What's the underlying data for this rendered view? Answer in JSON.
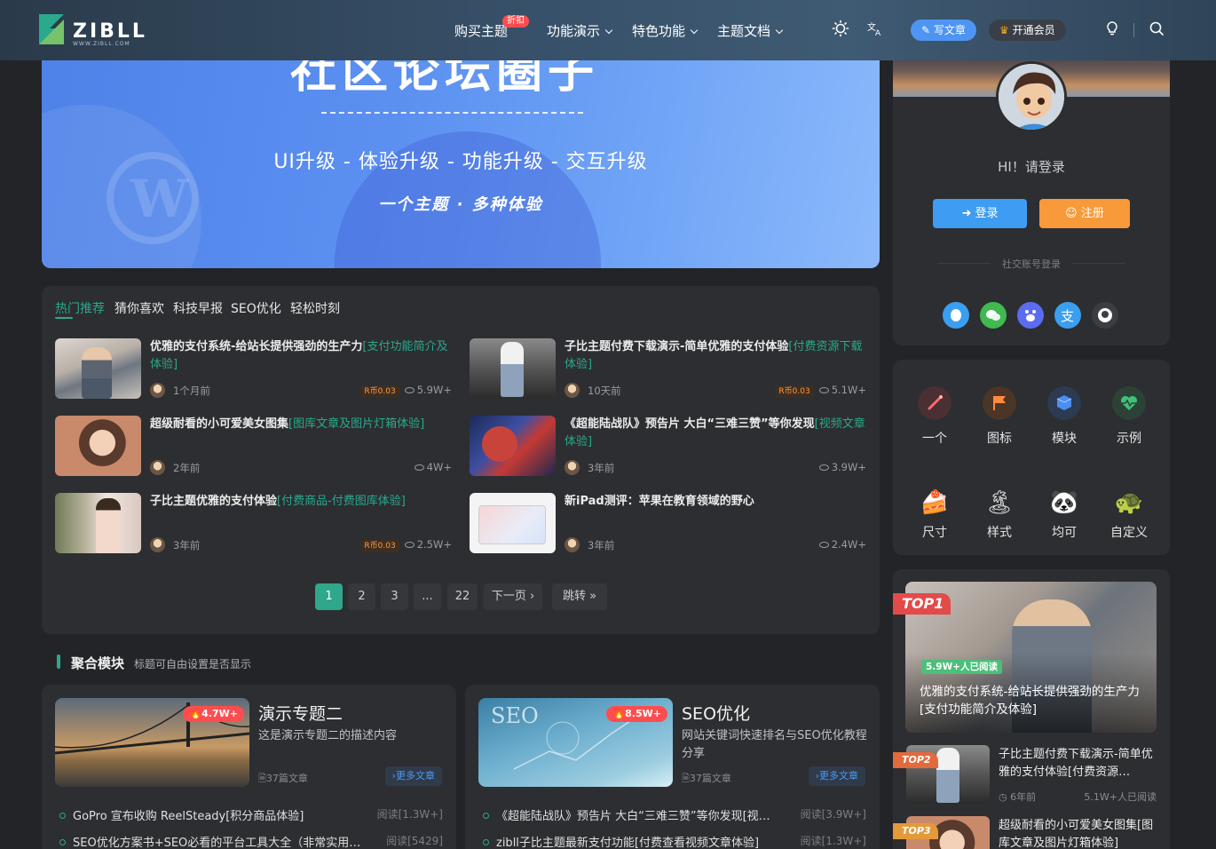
{
  "colors": {
    "accent": "#2aa98c",
    "header": "#38516a",
    "page_bg": "#232427",
    "panel_bg": "#2c2e31",
    "login": "#3e9cf3",
    "register": "#f89a3a",
    "hot": "#ff4d4f"
  },
  "header": {
    "logo_text": "ZIBLL",
    "logo_sub": "WWW.ZIBLL.COM",
    "nav": [
      {
        "label": "购买主题",
        "badge": "折扣"
      },
      {
        "label": "功能演示"
      },
      {
        "label": "特色功能"
      },
      {
        "label": "主题文档"
      }
    ],
    "write_label": "写文章",
    "vip_label": "开通会员",
    "icons": [
      "theme-toggle-icon",
      "translate-icon",
      "bulb-icon",
      "search-icon"
    ]
  },
  "banner": {
    "title": "社区论坛圈子",
    "subtitle": "UI升级 - 体验升级 - 功能升级 - 交互升级",
    "slogan": "一个主题 · 多种体验"
  },
  "posts": {
    "tabs": [
      "热门推荐",
      "猜你喜欢",
      "科技早报",
      "SEO优化",
      "轻松时刻"
    ],
    "items": [
      {
        "title": "优雅的支付系统-给站长提供强劲的生产力",
        "cat": "[支付功能简介及体验]",
        "time": "1个月前",
        "price": "R币0.03",
        "views": "5.9W+"
      },
      {
        "title": "子比主题付费下载演示-简单优雅的支付体验",
        "cat": "[付费资源下载体验]",
        "time": "10天前",
        "price": "R币0.03",
        "views": "5.1W+"
      },
      {
        "title": "超级耐看的小可爱美女图集",
        "cat": "[图库文章及图片灯箱体验]",
        "time": "2年前",
        "price": "",
        "views": "4W+"
      },
      {
        "title": "《超能陆战队》预告片 大白“三难三赞”等你发现",
        "cat": "[视频文章体验]",
        "time": "3年前",
        "price": "",
        "views": "3.9W+"
      },
      {
        "title": "子比主题优雅的支付体验",
        "cat": "[付费商品-付费图库体验]",
        "time": "3年前",
        "price": "R币0.03",
        "views": "2.5W+"
      },
      {
        "title": "新iPad测评：苹果在教育领域的野心",
        "cat": "",
        "time": "3年前",
        "price": "",
        "views": "2.4W+"
      }
    ],
    "pagination": [
      "1",
      "2",
      "3",
      "...",
      "22",
      "下一页 ›",
      "跳转 »"
    ]
  },
  "section": {
    "title": "聚合模块",
    "subtitle": "标题可自由设置是否显示"
  },
  "topics": [
    {
      "name": "演示专题二",
      "desc": "这是演示专题二的描述内容",
      "hot": "4.7W+",
      "count": "37篇文章",
      "more": "›更多文章",
      "list": [
        {
          "title": "GoPro 宣布收购 ReelSteady[积分商品体验]",
          "reads": "阅读[1.3W+]"
        },
        {
          "title": "SEO优化方案书+SEO必看的平台工具大全（非常实用…",
          "reads": "阅读[5429]"
        }
      ]
    },
    {
      "name": "SEO优化",
      "desc": "网站关键词快速排名与SEO优化教程分享",
      "hot": "8.5W+",
      "count": "37篇文章",
      "more": "›更多文章",
      "list": [
        {
          "title": "《超能陆战队》预告片 大白“三难三赞”等你发现[视…",
          "reads": "阅读[3.9W+]"
        },
        {
          "title": "zibll子比主题最新支付功能[付费查看视频文章体验]",
          "reads": "阅读[1.3W+]"
        }
      ]
    }
  ],
  "user": {
    "greeting": "HI！请登录",
    "login": "登录",
    "register": "注册",
    "social_label": "社交账号登录",
    "social_icons": [
      "qq-icon",
      "wechat-icon",
      "baidu-icon",
      "alipay-icon",
      "github-icon"
    ]
  },
  "icon_grid": [
    {
      "label": "一个",
      "icon": "wand-icon"
    },
    {
      "label": "图标",
      "icon": "flag-icon"
    },
    {
      "label": "模块",
      "icon": "cube-icon"
    },
    {
      "label": "示例",
      "icon": "heart-pulse-icon"
    },
    {
      "label": "尺寸",
      "icon": "cake-icon"
    },
    {
      "label": "样式",
      "icon": "island-icon"
    },
    {
      "label": "均可",
      "icon": "panda-icon"
    },
    {
      "label": "自定义",
      "icon": "turtle-icon"
    }
  ],
  "ranks": [
    {
      "tag": "TOP1",
      "reads": "5.9W+人已阅读",
      "title": "优雅的支付系统-给站长提供强劲的生产力[支付功能简介及体验]"
    },
    {
      "tag": "TOP2",
      "title": "子比主题付费下载演示-简单优雅的支付体验[付费资源…",
      "time": "6年前",
      "reads": "5.1W+人已阅读"
    },
    {
      "tag": "TOP3",
      "title": "超级耐看的小可爱美女图集[图库文章及图片灯箱体验]"
    }
  ]
}
